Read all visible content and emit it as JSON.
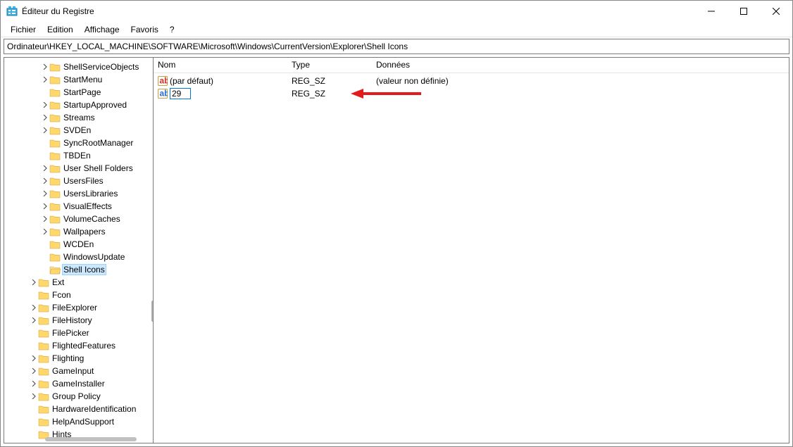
{
  "window": {
    "title": "Éditeur du Registre"
  },
  "menu": {
    "file": "Fichier",
    "edit": "Edition",
    "view": "Affichage",
    "favorites": "Favoris",
    "help": "?"
  },
  "address": "Ordinateur\\HKEY_LOCAL_MACHINE\\SOFTWARE\\Microsoft\\Windows\\CurrentVersion\\Explorer\\Shell Icons",
  "tree": [
    {
      "indent": 3,
      "expand": true,
      "label": "ShellServiceObjects"
    },
    {
      "indent": 3,
      "expand": true,
      "label": "StartMenu"
    },
    {
      "indent": 3,
      "expand": false,
      "label": "StartPage"
    },
    {
      "indent": 3,
      "expand": true,
      "label": "StartupApproved"
    },
    {
      "indent": 3,
      "expand": true,
      "label": "Streams"
    },
    {
      "indent": 3,
      "expand": true,
      "label": "SVDEn"
    },
    {
      "indent": 3,
      "expand": false,
      "label": "SyncRootManager"
    },
    {
      "indent": 3,
      "expand": false,
      "label": "TBDEn"
    },
    {
      "indent": 3,
      "expand": true,
      "label": "User Shell Folders"
    },
    {
      "indent": 3,
      "expand": true,
      "label": "UsersFiles"
    },
    {
      "indent": 3,
      "expand": true,
      "label": "UsersLibraries"
    },
    {
      "indent": 3,
      "expand": true,
      "label": "VisualEffects"
    },
    {
      "indent": 3,
      "expand": true,
      "label": "VolumeCaches"
    },
    {
      "indent": 3,
      "expand": true,
      "label": "Wallpapers"
    },
    {
      "indent": 3,
      "expand": false,
      "label": "WCDEn"
    },
    {
      "indent": 3,
      "expand": false,
      "label": "WindowsUpdate"
    },
    {
      "indent": 3,
      "expand": false,
      "label": "Shell Icons",
      "selected": true,
      "open": true
    },
    {
      "indent": 2,
      "expand": true,
      "label": "Ext"
    },
    {
      "indent": 2,
      "expand": false,
      "label": "Fcon"
    },
    {
      "indent": 2,
      "expand": true,
      "label": "FileExplorer"
    },
    {
      "indent": 2,
      "expand": true,
      "label": "FileHistory"
    },
    {
      "indent": 2,
      "expand": false,
      "label": "FilePicker"
    },
    {
      "indent": 2,
      "expand": false,
      "label": "FlightedFeatures"
    },
    {
      "indent": 2,
      "expand": true,
      "label": "Flighting"
    },
    {
      "indent": 2,
      "expand": true,
      "label": "GameInput"
    },
    {
      "indent": 2,
      "expand": true,
      "label": "GameInstaller"
    },
    {
      "indent": 2,
      "expand": true,
      "label": "Group Policy"
    },
    {
      "indent": 2,
      "expand": false,
      "label": "HardwareIdentification"
    },
    {
      "indent": 2,
      "expand": false,
      "label": "HelpAndSupport"
    },
    {
      "indent": 2,
      "expand": false,
      "label": "Hints"
    }
  ],
  "columns": {
    "name": "Nom",
    "type": "Type",
    "data": "Données"
  },
  "values": [
    {
      "icon": "ab-red",
      "name": "(par défaut)",
      "type": "REG_SZ",
      "data": "(valeur non définie)",
      "editing": false
    },
    {
      "icon": "ab-blue",
      "name": "29",
      "type": "REG_SZ",
      "data": "",
      "editing": true
    }
  ]
}
